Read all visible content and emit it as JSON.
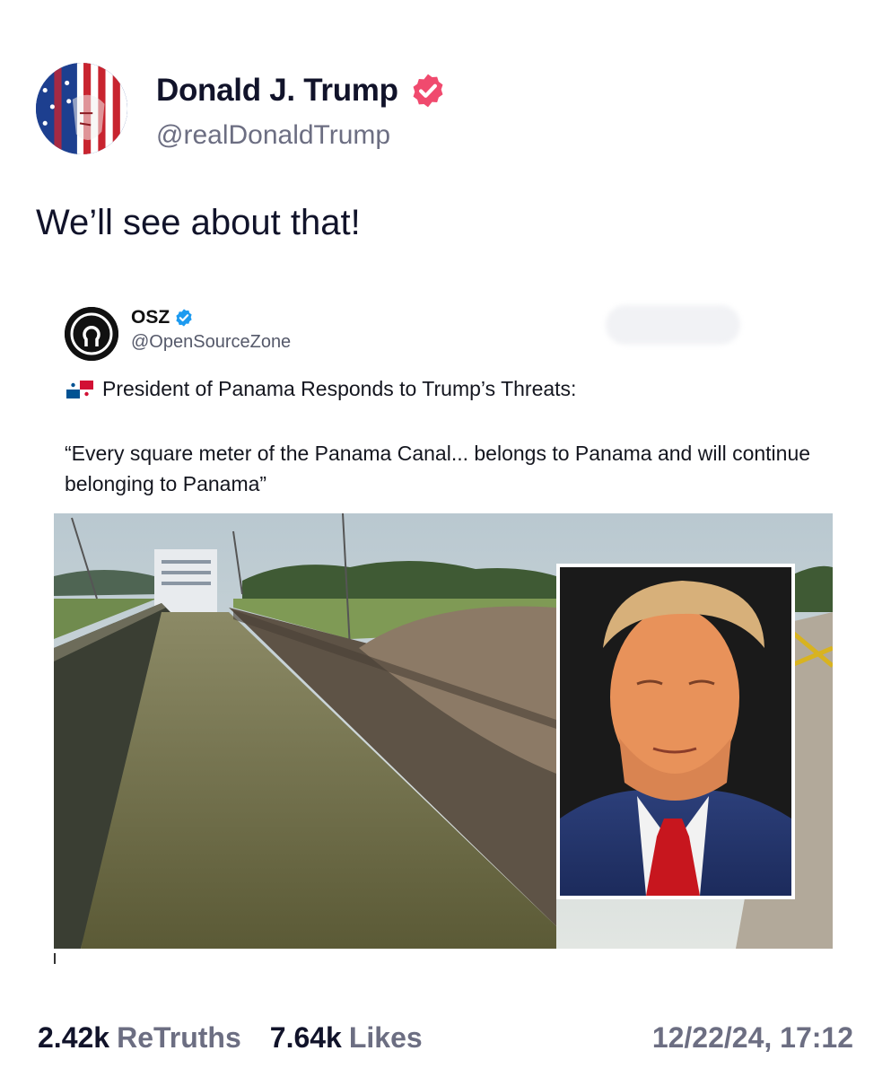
{
  "post": {
    "author_name": "Donald J. Trump",
    "handle": "@realDonaldTrump",
    "text": "We’ll see about that!",
    "verified_icon": "verified-badge-icon",
    "badge_color": "#f04a6e"
  },
  "quote": {
    "author_name": "OSZ",
    "handle": "@OpenSourceZone",
    "headline": "President of Panama Responds to Trump’s Threats:",
    "body": "“Every square meter of the Panama Canal... belongs to Panama and will continue belonging to Panama”",
    "badge_color": "#1d9bf0",
    "flag_icon": "panama-flag-icon"
  },
  "stats": {
    "retruths_count": "2.42k",
    "retruths_label": "ReTruths",
    "likes_count": "7.64k",
    "likes_label": "Likes",
    "timestamp": "12/22/24, 17:12"
  }
}
